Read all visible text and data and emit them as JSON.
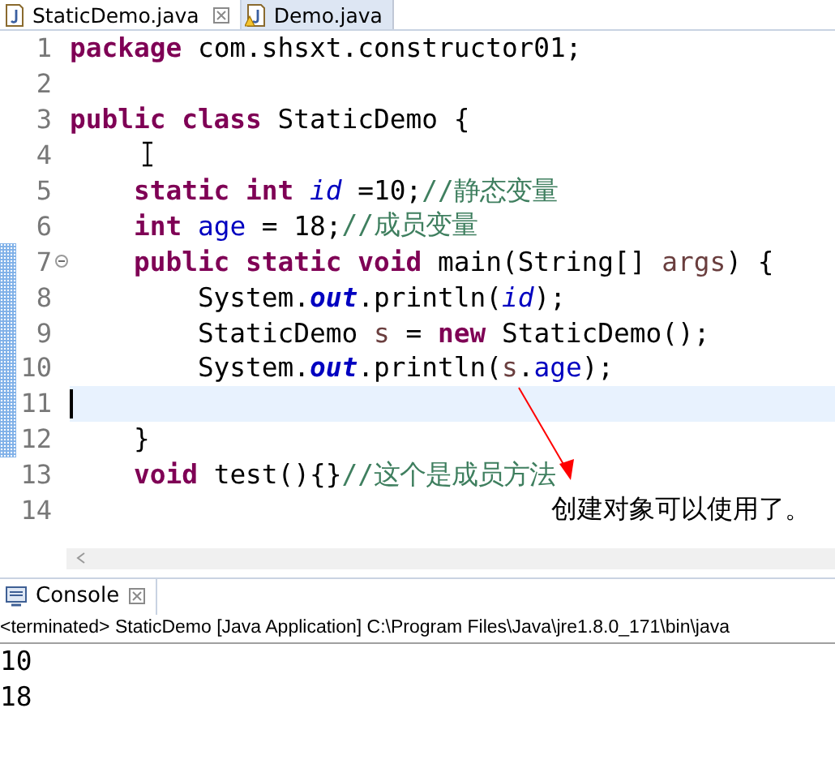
{
  "tabs": [
    {
      "label": "StaticDemo.java",
      "selected": true,
      "warning": false
    },
    {
      "label": "Demo.java",
      "selected": false,
      "warning": true
    }
  ],
  "editor": {
    "lines": [
      {
        "number": "1",
        "changed": false,
        "current": false,
        "foldable": false,
        "tokens": [
          {
            "kind": "keyword",
            "text": "package"
          },
          {
            "kind": "plain",
            "text": " com.shsxt.constructor01;"
          }
        ]
      },
      {
        "number": "2",
        "changed": false,
        "current": false,
        "foldable": false
      },
      {
        "number": "3",
        "changed": false,
        "current": false,
        "foldable": false,
        "tokens": [
          {
            "kind": "keyword",
            "text": "public class"
          },
          {
            "kind": "plain",
            "text": " StaticDemo {"
          }
        ]
      },
      {
        "number": "4",
        "changed": false,
        "current": false,
        "foldable": false
      },
      {
        "number": "5",
        "changed": false,
        "current": false,
        "foldable": false,
        "tokens": [
          {
            "kind": "keyword",
            "text": "    static int "
          },
          {
            "kind": "static-field",
            "text": "id"
          },
          {
            "kind": "plain",
            "text": " =10;"
          },
          {
            "kind": "comment",
            "text": "//静态变量"
          }
        ]
      },
      {
        "number": "6",
        "changed": false,
        "current": false,
        "foldable": false,
        "tokens": [
          {
            "kind": "keyword",
            "text": "    int "
          },
          {
            "kind": "field",
            "text": "age"
          },
          {
            "kind": "plain",
            "text": " = 18;"
          },
          {
            "kind": "comment",
            "text": "//成员变量"
          }
        ]
      },
      {
        "number": "7",
        "changed": true,
        "current": false,
        "foldable": true,
        "tokens": [
          {
            "kind": "keyword",
            "text": "    public static void"
          },
          {
            "kind": "plain",
            "text": " main(String[] "
          },
          {
            "kind": "local",
            "text": "args"
          },
          {
            "kind": "plain",
            "text": ") {"
          }
        ]
      },
      {
        "number": "8",
        "changed": true,
        "current": false,
        "foldable": false,
        "tokens": [
          {
            "kind": "plain",
            "text": "        System."
          },
          {
            "kind": "static-final",
            "text": "out"
          },
          {
            "kind": "plain",
            "text": ".println("
          },
          {
            "kind": "static-field",
            "text": "id"
          },
          {
            "kind": "plain",
            "text": ");"
          }
        ]
      },
      {
        "number": "9",
        "changed": true,
        "current": false,
        "foldable": false,
        "tokens": [
          {
            "kind": "plain",
            "text": "        StaticDemo "
          },
          {
            "kind": "local",
            "text": "s"
          },
          {
            "kind": "plain",
            "text": " = "
          },
          {
            "kind": "keyword",
            "text": "new"
          },
          {
            "kind": "plain",
            "text": " StaticDemo();"
          }
        ]
      },
      {
        "number": "10",
        "changed": true,
        "current": false,
        "foldable": false,
        "tokens": [
          {
            "kind": "plain",
            "text": "        System."
          },
          {
            "kind": "static-final",
            "text": "out"
          },
          {
            "kind": "plain",
            "text": ".println("
          },
          {
            "kind": "local",
            "text": "s"
          },
          {
            "kind": "plain",
            "text": "."
          },
          {
            "kind": "field",
            "text": "age"
          },
          {
            "kind": "plain",
            "text": ");"
          }
        ]
      },
      {
        "number": "11",
        "changed": true,
        "current": true,
        "foldable": false
      },
      {
        "number": "12",
        "changed": true,
        "current": false,
        "foldable": false,
        "tokens": [
          {
            "kind": "plain",
            "text": "    }"
          }
        ]
      },
      {
        "number": "13",
        "changed": false,
        "current": false,
        "foldable": false,
        "tokens": [
          {
            "kind": "keyword",
            "text": "    void"
          },
          {
            "kind": "plain",
            "text": " test(){}"
          },
          {
            "kind": "comment",
            "text": "//这个是成员方法"
          }
        ]
      },
      {
        "number": "14",
        "changed": false,
        "current": false,
        "foldable": false
      }
    ]
  },
  "annotation": {
    "text": "创建对象可以使用了。"
  },
  "console": {
    "title": "Console",
    "status": "<terminated> StaticDemo [Java Application] C:\\Program Files\\Java\\jre1.8.0_171\\bin\\java",
    "output": [
      "10",
      "18"
    ]
  }
}
